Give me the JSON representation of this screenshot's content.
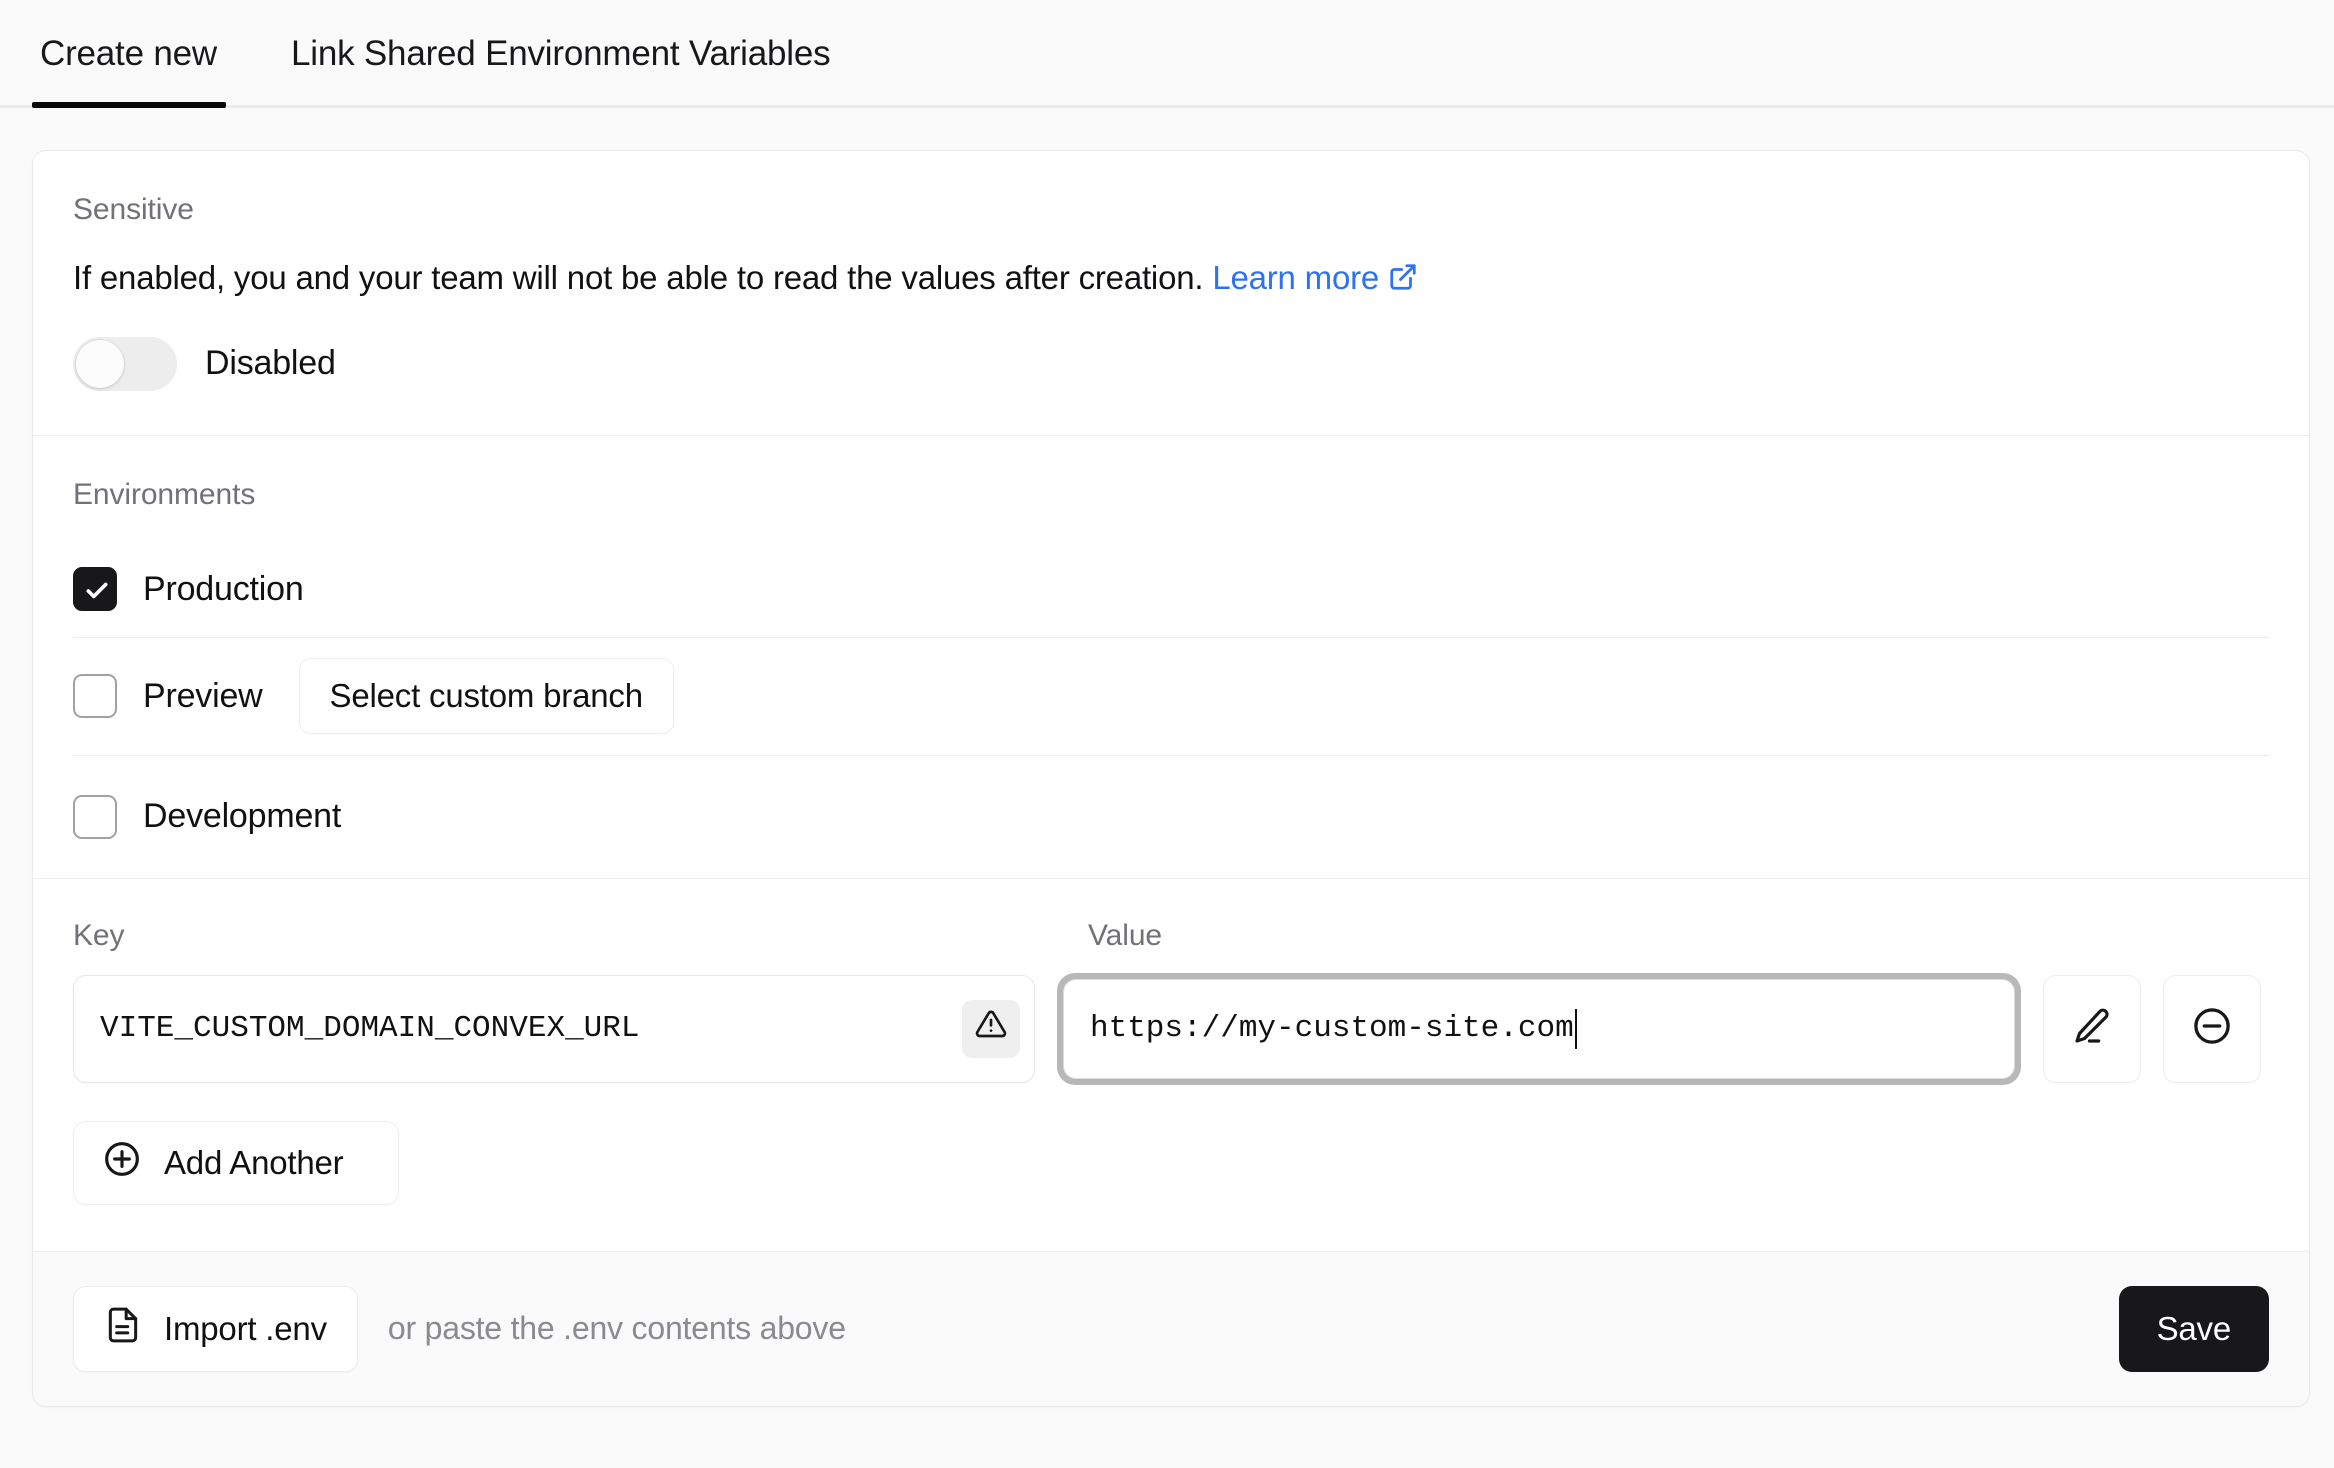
{
  "tabs": [
    {
      "label": "Create new",
      "active": true
    },
    {
      "label": "Link Shared Environment Variables",
      "active": false
    }
  ],
  "sensitive": {
    "section_label": "Sensitive",
    "description": "If enabled, you and your team will not be able to read the values after creation.",
    "learn_more_label": "Learn more",
    "toggle_state_label": "Disabled",
    "toggle_on": false
  },
  "environments": {
    "section_label": "Environments",
    "rows": [
      {
        "label": "Production",
        "checked": true,
        "button": null
      },
      {
        "label": "Preview",
        "checked": false,
        "button": "Select custom branch"
      },
      {
        "label": "Development",
        "checked": false,
        "button": null
      }
    ]
  },
  "variables": {
    "key_header": "Key",
    "value_header": "Value",
    "rows": [
      {
        "key": "VITE_CUSTOM_DOMAIN_CONVEX_URL",
        "value": "https://my-custom-site.com",
        "key_warning": true,
        "value_focused": true
      }
    ],
    "add_another_label": "Add Another"
  },
  "footer": {
    "import_label": "Import .env",
    "hint": "or paste the .env contents above",
    "save_label": "Save"
  },
  "colors": {
    "link": "#2f72f0",
    "accent_dark": "#18181b",
    "muted_text": "#71717a",
    "border": "#ececec"
  }
}
